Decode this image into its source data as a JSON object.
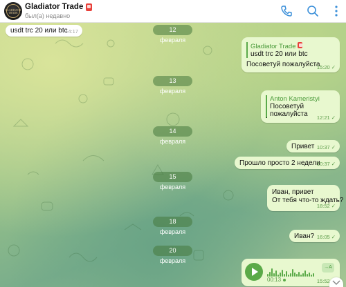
{
  "chat": {
    "title": "Gladiator Trade",
    "status": "был(а) недавно",
    "avatar_text": "GLADIATOR TRADE"
  },
  "header_icons": [
    "phone-icon",
    "search-icon",
    "more-icon"
  ],
  "messages": {
    "m1": {
      "text": "usdt trc 20 или btc",
      "time": "14:17"
    },
    "d1": "12 февраля",
    "m2": {
      "quote_name": "Gladiator Trade",
      "quote_text": "usdt trc 20 или btc",
      "text": "Посоветуй пожалуйста",
      "time": "15:20"
    },
    "d2": "13 февраля",
    "m3": {
      "quote_name": "Anton Kameristyi",
      "quote_text": "Посоветуй пожалуйста",
      "text": ".",
      "time": "12:21"
    },
    "d3": "14 февраля",
    "m4": {
      "text": "Привет",
      "time": "10:37"
    },
    "m5": {
      "text": "Прошло просто 2 недели",
      "time": "10:37"
    },
    "d4": "15 февраля",
    "m6": {
      "line1": "Иван, привет",
      "line2": "От тебя что-то ждать?",
      "time": "18:52"
    },
    "d5": "18 февраля",
    "m7": {
      "text": "Иван?",
      "time": "16:05"
    },
    "d6": "20 февраля",
    "m8": {
      "duration": "00:13",
      "time": "15:52",
      "transcribe": "→A"
    }
  },
  "colors": {
    "accent": "#5aaa48",
    "bubble_out": "#e8f8cf",
    "header_icon": "#3a8fd9"
  }
}
